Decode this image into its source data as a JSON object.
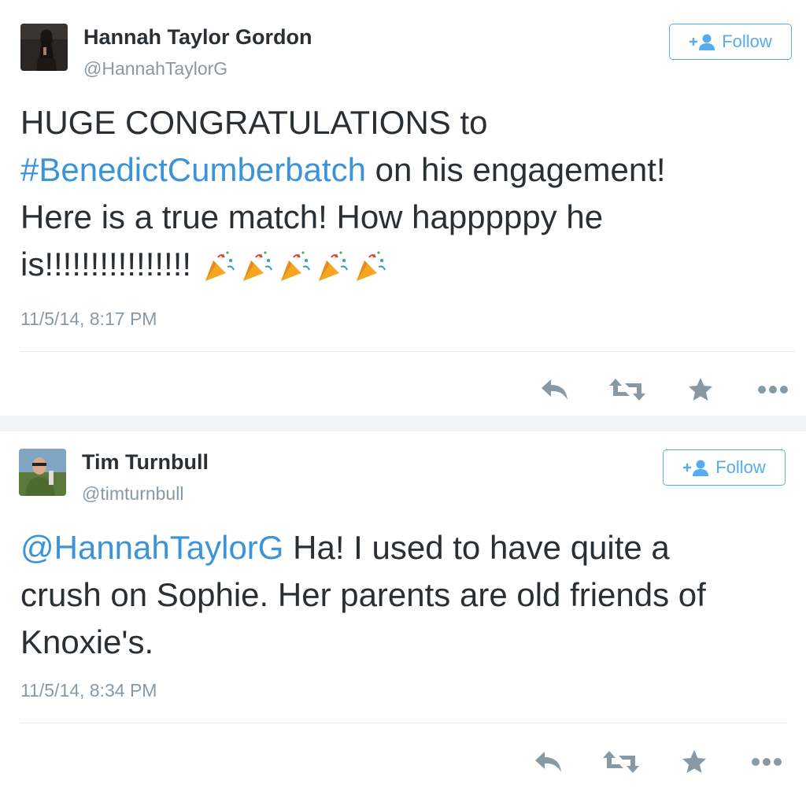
{
  "tweets": [
    {
      "name": "Hannah Taylor Gordon",
      "handle": "@HannahTaylorG",
      "follow_label": "Follow",
      "body_line1": "HUGE CONGRATULATIONS to",
      "hashtag": "#BenedictCumberbatch",
      "body_line2_rest": " on his engagement!",
      "body_line3": "Here is a true match! How happpppy he",
      "body_line4": "is!!!!!!!!!!!!!!!!",
      "emoji": "party-popper x5",
      "timestamp": "11/5/14, 8:17 PM"
    },
    {
      "name": "Tim Turnbull",
      "handle": "@timturnbull",
      "follow_label": "Follow",
      "mention": "@HannahTaylorG",
      "body_line1_rest": " Ha! I used to have quite a",
      "body_line2": "crush on Sophie. Her parents are old friends of",
      "body_line3": "Knoxie's.",
      "timestamp": "11/5/14, 8:34 PM"
    }
  ],
  "icons": {
    "reply": "reply-icon",
    "retweet": "retweet-icon",
    "favorite": "star-icon",
    "more": "more-dots-icon",
    "follow": "add-user-icon"
  },
  "colors": {
    "link": "#3b94d9",
    "accent": "#55acee",
    "muted": "#8899a6",
    "text": "#292f33",
    "icon": "#8899a6"
  }
}
